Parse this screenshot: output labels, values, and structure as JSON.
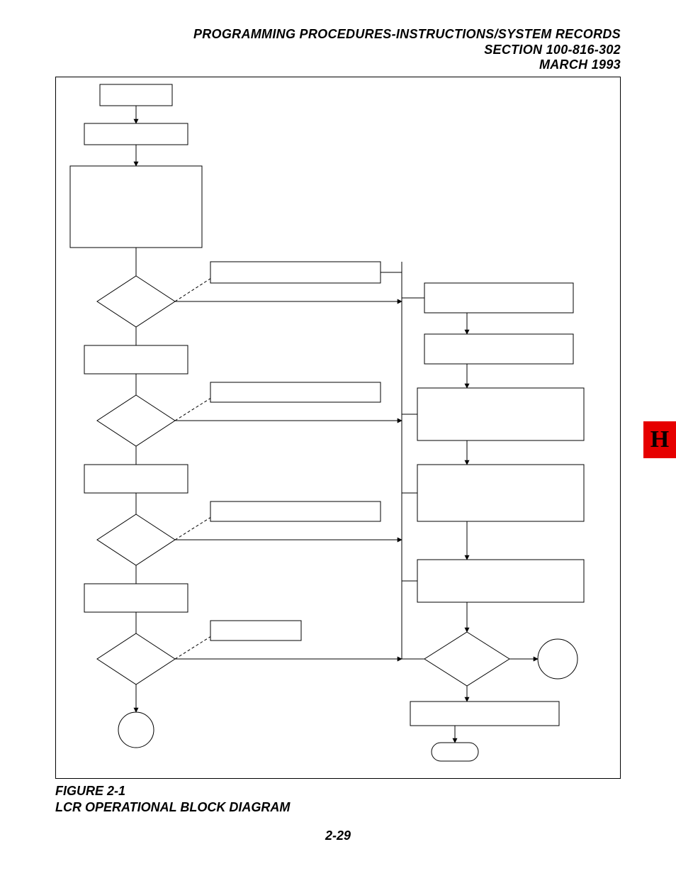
{
  "header": {
    "line1": "PROGRAMMING PROCEDURES-INSTRUCTIONS/SYSTEM RECORDS",
    "line2": "SECTION 100-816-302",
    "line3": "MARCH 1993"
  },
  "caption": {
    "line1": "FIGURE 2-1",
    "line2": "LCR OPERATIONAL BLOCK DIAGRAM"
  },
  "page_number": "2-29",
  "side_tab": "H",
  "flowchart": {
    "nodes": [
      {
        "id": "n1",
        "type": "process",
        "label": ""
      },
      {
        "id": "n2",
        "type": "process",
        "label": ""
      },
      {
        "id": "n3",
        "type": "process",
        "label": ""
      },
      {
        "id": "d1",
        "type": "decision",
        "label": ""
      },
      {
        "id": "a1",
        "type": "process",
        "label": ""
      },
      {
        "id": "n4",
        "type": "process",
        "label": ""
      },
      {
        "id": "d2",
        "type": "decision",
        "label": ""
      },
      {
        "id": "a2",
        "type": "process",
        "label": ""
      },
      {
        "id": "n5",
        "type": "process",
        "label": ""
      },
      {
        "id": "d3",
        "type": "decision",
        "label": ""
      },
      {
        "id": "a3",
        "type": "process",
        "label": ""
      },
      {
        "id": "n6",
        "type": "process",
        "label": ""
      },
      {
        "id": "d4",
        "type": "decision",
        "label": ""
      },
      {
        "id": "a4",
        "type": "process",
        "label": ""
      },
      {
        "id": "c1",
        "type": "connector",
        "label": ""
      },
      {
        "id": "r1",
        "type": "process",
        "label": ""
      },
      {
        "id": "r2",
        "type": "process",
        "label": ""
      },
      {
        "id": "r3",
        "type": "process",
        "label": ""
      },
      {
        "id": "r4",
        "type": "process",
        "label": ""
      },
      {
        "id": "r5",
        "type": "process",
        "label": ""
      },
      {
        "id": "rd",
        "type": "decision",
        "label": ""
      },
      {
        "id": "rc",
        "type": "connector",
        "label": ""
      },
      {
        "id": "r6",
        "type": "process",
        "label": ""
      },
      {
        "id": "rt",
        "type": "terminator",
        "label": ""
      }
    ],
    "edges": [
      {
        "from": "n1",
        "to": "n2"
      },
      {
        "from": "n2",
        "to": "n3"
      },
      {
        "from": "n3",
        "to": "d1"
      },
      {
        "from": "d1",
        "to": "a1",
        "style": "dashed"
      },
      {
        "from": "d1",
        "to": "n4"
      },
      {
        "from": "a1",
        "to": "r1"
      },
      {
        "from": "n4",
        "to": "d2"
      },
      {
        "from": "d2",
        "to": "a2",
        "style": "dashed"
      },
      {
        "from": "d2",
        "to": "n5"
      },
      {
        "from": "a2",
        "to": "r3_in"
      },
      {
        "from": "n5",
        "to": "d3"
      },
      {
        "from": "d3",
        "to": "a3",
        "style": "dashed"
      },
      {
        "from": "d3",
        "to": "n6"
      },
      {
        "from": "a3",
        "to": "r4_in"
      },
      {
        "from": "n6",
        "to": "d4"
      },
      {
        "from": "d4",
        "to": "a4",
        "style": "dashed"
      },
      {
        "from": "d4",
        "to": "c1"
      },
      {
        "from": "a4",
        "to": "rd_in"
      },
      {
        "from": "r1",
        "to": "r2"
      },
      {
        "from": "r2",
        "to": "r3"
      },
      {
        "from": "r3",
        "to": "r4"
      },
      {
        "from": "r4",
        "to": "r5"
      },
      {
        "from": "r5",
        "to": "rd"
      },
      {
        "from": "rd",
        "to": "rc"
      },
      {
        "from": "rd",
        "to": "r6"
      },
      {
        "from": "r6",
        "to": "rt"
      }
    ]
  }
}
